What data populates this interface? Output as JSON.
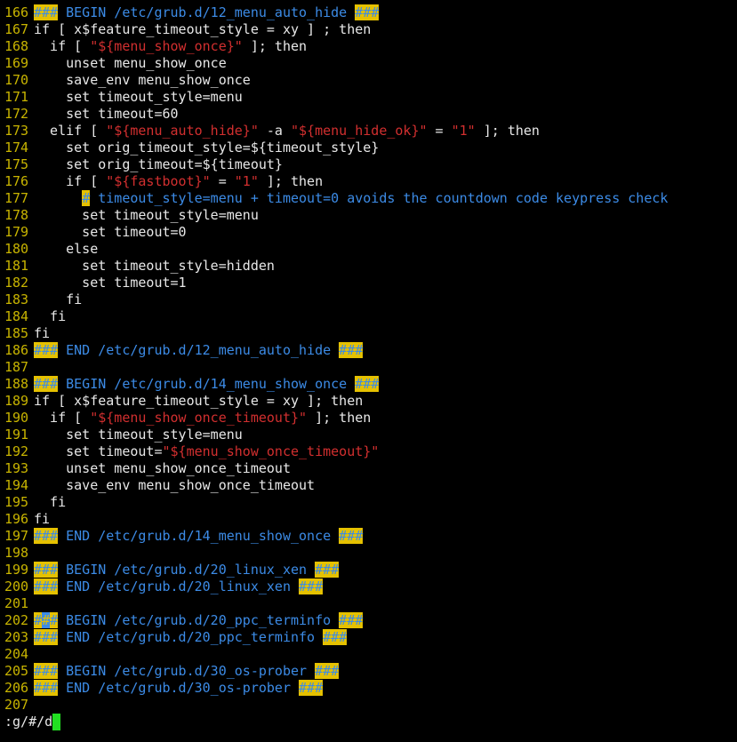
{
  "editor": {
    "colors": {
      "background": "#000000",
      "line_number": "#c8b400",
      "text": "#e8e8e8",
      "comment": "#3c8be6",
      "search_highlight": "#e5c100",
      "string": "#d22f2f",
      "cursor": "#22e022"
    },
    "lines": [
      {
        "n": "166",
        "segs": [
          {
            "t": "###",
            "c": "hl"
          },
          {
            "t": " BEGIN /etc/grub.d/12_menu_auto_hide ",
            "c": "comment"
          },
          {
            "t": "###",
            "c": "hl"
          }
        ]
      },
      {
        "n": "167",
        "segs": [
          {
            "t": "if [ x$feature_timeout_style = xy ] ; then",
            "c": "plain"
          }
        ]
      },
      {
        "n": "168",
        "segs": [
          {
            "t": "  if [ ",
            "c": "plain"
          },
          {
            "t": "\"${menu_show_once}\"",
            "c": "str"
          },
          {
            "t": " ]; then",
            "c": "plain"
          }
        ]
      },
      {
        "n": "169",
        "segs": [
          {
            "t": "    unset menu_show_once",
            "c": "plain"
          }
        ]
      },
      {
        "n": "170",
        "segs": [
          {
            "t": "    save_env menu_show_once",
            "c": "plain"
          }
        ]
      },
      {
        "n": "171",
        "segs": [
          {
            "t": "    set timeout_style=menu",
            "c": "plain"
          }
        ]
      },
      {
        "n": "172",
        "segs": [
          {
            "t": "    set timeout=60",
            "c": "plain"
          }
        ]
      },
      {
        "n": "173",
        "segs": [
          {
            "t": "  elif [ ",
            "c": "plain"
          },
          {
            "t": "\"${menu_auto_hide}\"",
            "c": "str"
          },
          {
            "t": " -a ",
            "c": "plain"
          },
          {
            "t": "\"${menu_hide_ok}\"",
            "c": "str"
          },
          {
            "t": " = ",
            "c": "plain"
          },
          {
            "t": "\"1\"",
            "c": "str"
          },
          {
            "t": " ]; then",
            "c": "plain"
          }
        ]
      },
      {
        "n": "174",
        "segs": [
          {
            "t": "    set orig_timeout_style=${timeout_style}",
            "c": "plain"
          }
        ]
      },
      {
        "n": "175",
        "segs": [
          {
            "t": "    set orig_timeout=${timeout}",
            "c": "plain"
          }
        ]
      },
      {
        "n": "176",
        "segs": [
          {
            "t": "    if [ ",
            "c": "plain"
          },
          {
            "t": "\"${fastboot}\"",
            "c": "str"
          },
          {
            "t": " = ",
            "c": "plain"
          },
          {
            "t": "\"1\"",
            "c": "str"
          },
          {
            "t": " ]; then",
            "c": "plain"
          }
        ]
      },
      {
        "n": "177",
        "segs": [
          {
            "t": "      ",
            "c": "plain"
          },
          {
            "t": "#",
            "c": "hl"
          },
          {
            "t": " timeout_style=menu + timeout=0 avoids the countdown code keypress check",
            "c": "comment"
          }
        ]
      },
      {
        "n": "178",
        "segs": [
          {
            "t": "      set timeout_style=menu",
            "c": "plain"
          }
        ]
      },
      {
        "n": "179",
        "segs": [
          {
            "t": "      set timeout=0",
            "c": "plain"
          }
        ]
      },
      {
        "n": "180",
        "segs": [
          {
            "t": "    else",
            "c": "plain"
          }
        ]
      },
      {
        "n": "181",
        "segs": [
          {
            "t": "      set timeout_style=hidden",
            "c": "plain"
          }
        ]
      },
      {
        "n": "182",
        "segs": [
          {
            "t": "      set timeout=1",
            "c": "plain"
          }
        ]
      },
      {
        "n": "183",
        "segs": [
          {
            "t": "    fi",
            "c": "plain"
          }
        ]
      },
      {
        "n": "184",
        "segs": [
          {
            "t": "  fi",
            "c": "plain"
          }
        ]
      },
      {
        "n": "185",
        "segs": [
          {
            "t": "fi",
            "c": "plain"
          }
        ]
      },
      {
        "n": "186",
        "segs": [
          {
            "t": "###",
            "c": "hl"
          },
          {
            "t": " END /etc/grub.d/12_menu_auto_hide ",
            "c": "comment"
          },
          {
            "t": "###",
            "c": "hl"
          }
        ]
      },
      {
        "n": "187",
        "segs": []
      },
      {
        "n": "188",
        "segs": [
          {
            "t": "###",
            "c": "hl"
          },
          {
            "t": " BEGIN /etc/grub.d/14_menu_show_once ",
            "c": "comment"
          },
          {
            "t": "###",
            "c": "hl"
          }
        ]
      },
      {
        "n": "189",
        "segs": [
          {
            "t": "if [ x$feature_timeout_style = xy ]; then",
            "c": "plain"
          }
        ]
      },
      {
        "n": "190",
        "segs": [
          {
            "t": "  if [ ",
            "c": "plain"
          },
          {
            "t": "\"${menu_show_once_timeout}\"",
            "c": "str"
          },
          {
            "t": " ]; then",
            "c": "plain"
          }
        ]
      },
      {
        "n": "191",
        "segs": [
          {
            "t": "    set timeout_style=menu",
            "c": "plain"
          }
        ]
      },
      {
        "n": "192",
        "segs": [
          {
            "t": "    set timeout=",
            "c": "plain"
          },
          {
            "t": "\"${menu_show_once_timeout}\"",
            "c": "str"
          }
        ]
      },
      {
        "n": "193",
        "segs": [
          {
            "t": "    unset menu_show_once_timeout",
            "c": "plain"
          }
        ]
      },
      {
        "n": "194",
        "segs": [
          {
            "t": "    save_env menu_show_once_timeout",
            "c": "plain"
          }
        ]
      },
      {
        "n": "195",
        "segs": [
          {
            "t": "  fi",
            "c": "plain"
          }
        ]
      },
      {
        "n": "196",
        "segs": [
          {
            "t": "fi",
            "c": "plain"
          }
        ]
      },
      {
        "n": "197",
        "segs": [
          {
            "t": "###",
            "c": "hl"
          },
          {
            "t": " END /etc/grub.d/14_menu_show_once ",
            "c": "comment"
          },
          {
            "t": "###",
            "c": "hl"
          }
        ]
      },
      {
        "n": "198",
        "segs": []
      },
      {
        "n": "199",
        "segs": [
          {
            "t": "###",
            "c": "hl"
          },
          {
            "t": " BEGIN /etc/grub.d/20_linux_xen ",
            "c": "comment"
          },
          {
            "t": "###",
            "c": "hl"
          }
        ]
      },
      {
        "n": "200",
        "segs": [
          {
            "t": "###",
            "c": "hl"
          },
          {
            "t": " END /etc/grub.d/20_linux_xen ",
            "c": "comment"
          },
          {
            "t": "###",
            "c": "hl"
          }
        ]
      },
      {
        "n": "201",
        "segs": []
      },
      {
        "n": "202",
        "segs": [
          {
            "t": "#",
            "c": "hl"
          },
          {
            "t": "#",
            "c": "hlcursor"
          },
          {
            "t": "#",
            "c": "hl"
          },
          {
            "t": " BEGIN /etc/grub.d/20_ppc_terminfo ",
            "c": "comment"
          },
          {
            "t": "###",
            "c": "hl"
          }
        ]
      },
      {
        "n": "203",
        "segs": [
          {
            "t": "###",
            "c": "hl"
          },
          {
            "t": " END /etc/grub.d/20_ppc_terminfo ",
            "c": "comment"
          },
          {
            "t": "###",
            "c": "hl"
          }
        ]
      },
      {
        "n": "204",
        "segs": []
      },
      {
        "n": "205",
        "segs": [
          {
            "t": "###",
            "c": "hl"
          },
          {
            "t": " BEGIN /etc/grub.d/30_os-prober ",
            "c": "comment"
          },
          {
            "t": "###",
            "c": "hl"
          }
        ]
      },
      {
        "n": "206",
        "segs": [
          {
            "t": "###",
            "c": "hl"
          },
          {
            "t": " END /etc/grub.d/30_os-prober ",
            "c": "comment"
          },
          {
            "t": "###",
            "c": "hl"
          }
        ]
      },
      {
        "n": "207",
        "segs": []
      }
    ]
  },
  "command_line": {
    "text": ":g/#/d"
  }
}
